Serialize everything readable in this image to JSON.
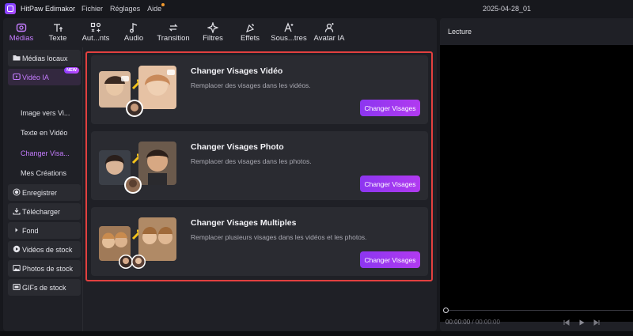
{
  "titlebar": {
    "app_name": "HitPaw Edimakor",
    "menus": [
      "Fichier",
      "Réglages",
      "Aide"
    ],
    "project_name": "2025-04-28_01"
  },
  "toolbar": {
    "items": [
      {
        "label": "Médias",
        "icon": "media-icon",
        "active": true
      },
      {
        "label": "Texte",
        "icon": "text-icon"
      },
      {
        "label": "Aut...nts",
        "icon": "ai-tools-icon"
      },
      {
        "label": "Audio",
        "icon": "music-note-icon"
      },
      {
        "label": "Transition",
        "icon": "transition-icon"
      },
      {
        "label": "Filtres",
        "icon": "sparkle-icon"
      },
      {
        "label": "Effets",
        "icon": "effects-icon"
      },
      {
        "label": "Sous...tres",
        "icon": "subtitle-icon"
      },
      {
        "label": "Avatar IA",
        "icon": "avatar-icon"
      }
    ]
  },
  "sidebar": {
    "local_media": "Médias locaux",
    "ai_video": "Vidéo IA",
    "new_badge": "NEW",
    "subitems": [
      "Image vers Vi...",
      "Texte en Vidéo",
      "Changer Visa...",
      "Mes Créations"
    ],
    "items": [
      "Enregistrer",
      "Télécharger",
      "Fond",
      "Vidéos de stock",
      "Photos de stock",
      "GIFs de stock"
    ]
  },
  "cards": [
    {
      "title": "Changer Visages Vidéo",
      "description": "Remplacer des visages dans les vidéos.",
      "button": "Changer Visages"
    },
    {
      "title": "Changer Visages Photo",
      "description": "Remplacer des visages dans les photos.",
      "button": "Changer Visages"
    },
    {
      "title": "Changer Visages Multiples",
      "description": "Remplacer plusieurs visages dans les vidéos et les photos.",
      "button": "Changer Visages"
    }
  ],
  "preview": {
    "title": "Lecture",
    "current_time": "00:00:00",
    "separator": " / ",
    "total_time": "00:00:00",
    "playhead_progress": 0
  },
  "colors": {
    "accent": "#b13af0",
    "highlight_border": "#e2403f",
    "background": "#17181d"
  }
}
